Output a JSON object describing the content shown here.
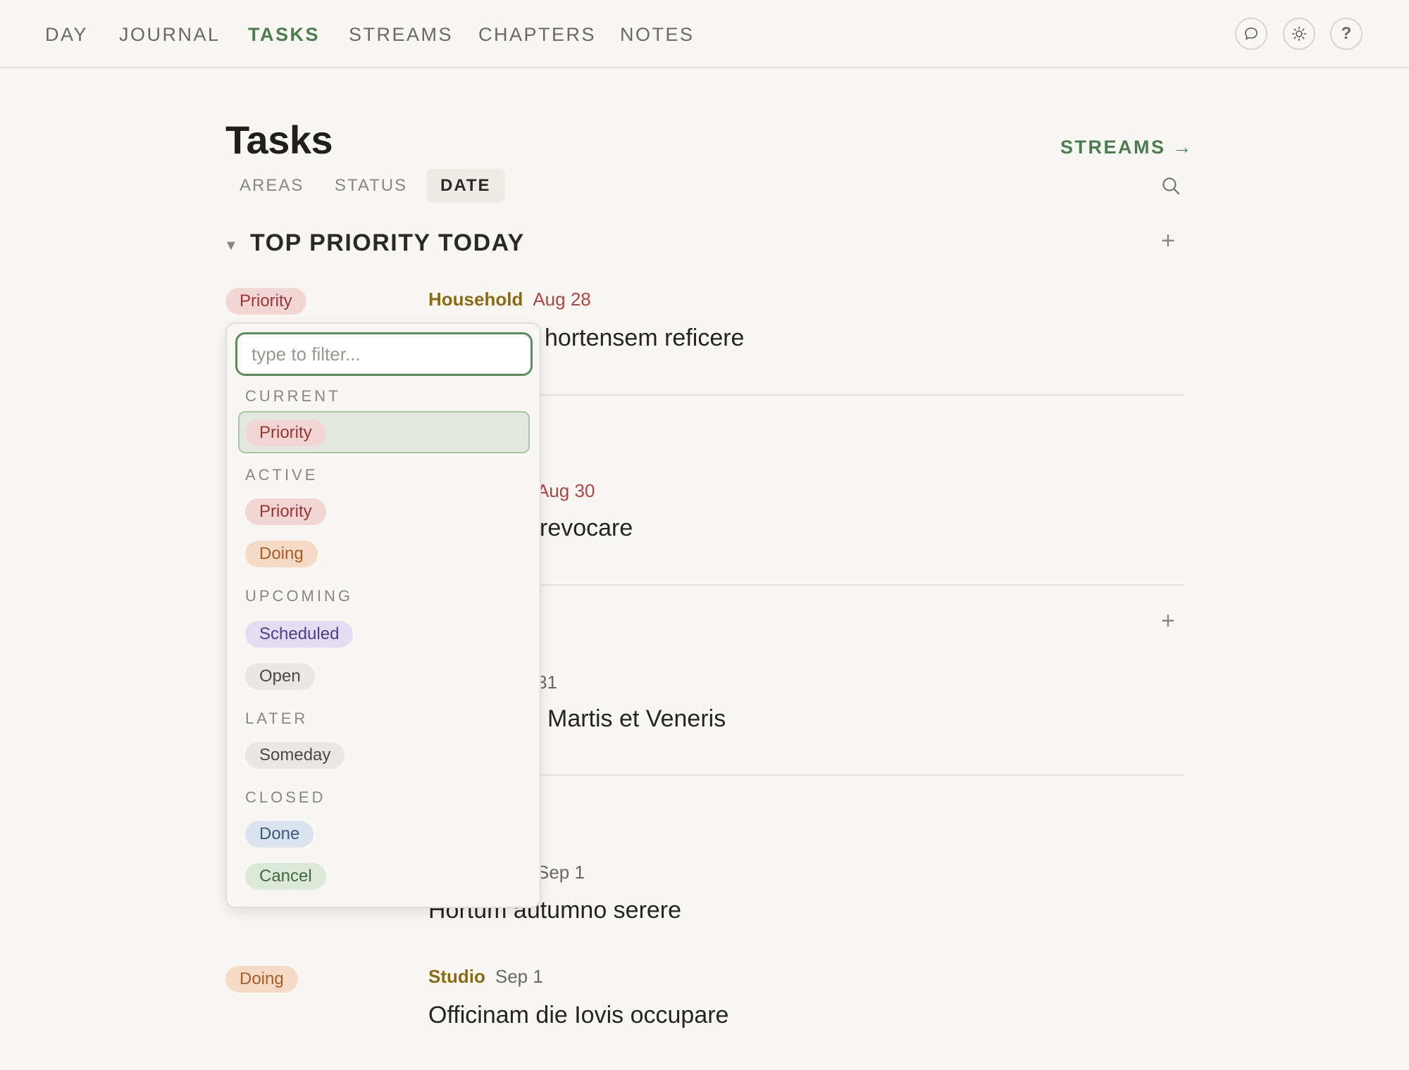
{
  "nav": {
    "items": [
      "DAY",
      "JOURNAL",
      "TASKS",
      "STREAMS",
      "CHAPTERS",
      "NOTES"
    ],
    "active": "TASKS",
    "icons": [
      "chat-icon",
      "sun-icon",
      "help-icon"
    ],
    "help_label": "?"
  },
  "header": {
    "title": "Tasks",
    "streams_link": "STREAMS →",
    "tabs": [
      "AREAS",
      "STATUS",
      "DATE"
    ],
    "active_tab": "DATE"
  },
  "section": {
    "title": "TOP PRIORITY TODAY"
  },
  "tasks": [
    {
      "status": "Priority",
      "area": "Household",
      "date": "Aug 28",
      "title": "hortensem reficere"
    },
    {
      "date": "Aug 30",
      "title": "revocare"
    },
    {
      "date": "31",
      "title": "Martis et Veneris"
    },
    {
      "date": "Sep 1",
      "title": "Hortum autumno serere"
    },
    {
      "status": "Doing",
      "area": "Studio",
      "date": "Sep 1",
      "title": "Officinam die Iovis occupare"
    }
  ],
  "dropdown": {
    "placeholder": "type to filter...",
    "groups": [
      {
        "label": "CURRENT",
        "options": [
          "Priority"
        ]
      },
      {
        "label": "ACTIVE",
        "options": [
          "Priority",
          "Doing"
        ]
      },
      {
        "label": "UPCOMING",
        "options": [
          "Scheduled",
          "Open"
        ]
      },
      {
        "label": "LATER",
        "options": [
          "Someday"
        ]
      },
      {
        "label": "CLOSED",
        "options": [
          "Done",
          "Cancel"
        ]
      }
    ]
  },
  "colors": {
    "accent": "#4b7d4f",
    "background": "#f8f7f4",
    "priority": "#9a3535",
    "doing": "#a85d25",
    "scheduled": "#4d3f8a",
    "done": "#3c5a7d",
    "cancel": "#3c6b3d",
    "area": "#8b6a12",
    "date_overdue": "#b24343"
  }
}
